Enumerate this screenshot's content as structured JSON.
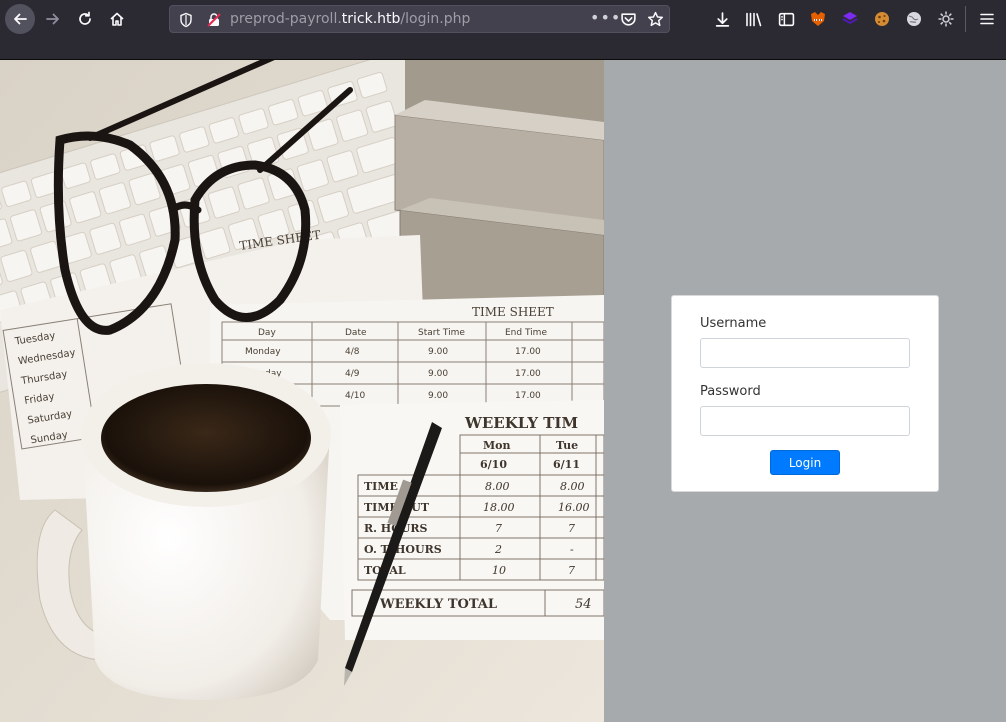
{
  "browser": {
    "url_prefix": "preprod-payroll.",
    "url_domain": "trick.htb",
    "url_path": "/login.php"
  },
  "hero": {
    "timesheet_title": "TIME SHEET",
    "timesheet_title_2": "TIME SHEET",
    "weekly_title": "WEEKLY TIM",
    "days_left": [
      "Tuesday",
      "Wednesday",
      "Thursday",
      "Friday",
      "Saturday",
      "Sunday"
    ],
    "headers_mid": [
      "Day",
      "Date",
      "Start Time",
      "End Time"
    ],
    "mid_rows": [
      [
        "Monday",
        "4/8",
        "9.00",
        "17.00"
      ],
      [
        "Tuesday",
        "4/9",
        "9.00",
        "17.00"
      ],
      [
        "",
        "4/10",
        "9.00",
        "17.00"
      ]
    ],
    "weekly_headers": [
      "Mon",
      "Tue"
    ],
    "weekly_dates": [
      "6/10",
      "6/11"
    ],
    "weekly_rows": [
      {
        "label": "TIME IN",
        "mon": "8.00",
        "tue": "8.00"
      },
      {
        "label": "TIME OUT",
        "mon": "18.00",
        "tue": "16.00"
      },
      {
        "label": "R. HOURS",
        "mon": "7",
        "tue": "7"
      },
      {
        "label": "O. T. HOURS",
        "mon": "2",
        "tue": "-"
      },
      {
        "label": "TOTAL",
        "mon": "10",
        "tue": "7"
      }
    ],
    "weekly_total_label": "WEEKLY TOTAL",
    "weekly_total_value": "54"
  },
  "login": {
    "username_label": "Username",
    "username_value": "",
    "password_label": "Password",
    "password_value": "",
    "button_label": "Login"
  },
  "colors": {
    "accent": "#007bff",
    "right_pane_bg": "#a7aaad",
    "chrome_bg": "#2b2a33"
  }
}
